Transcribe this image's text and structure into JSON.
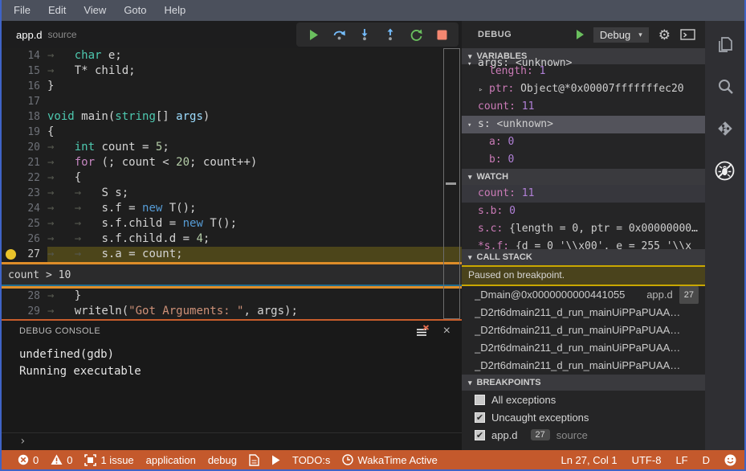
{
  "window": {
    "border_color": "#3f63c6",
    "accent_orange": "#c4592c",
    "accent_yellow": "#e9c32a"
  },
  "menu": {
    "items": [
      "File",
      "Edit",
      "View",
      "Goto",
      "Help"
    ]
  },
  "tab": {
    "file": "app.d",
    "hint": "source"
  },
  "debug_toolbar": {
    "buttons": [
      {
        "icon": "continue-icon"
      },
      {
        "icon": "step-over-icon"
      },
      {
        "icon": "step-into-icon"
      },
      {
        "icon": "step-out-icon"
      },
      {
        "icon": "restart-icon"
      },
      {
        "icon": "stop-icon"
      }
    ]
  },
  "editor": {
    "current_line": 27,
    "breakpoint_line": 27,
    "condition_text": "count > 10",
    "lines": [
      {
        "num": 14,
        "tokens": [
          [
            "ws",
            "→   "
          ],
          [
            "kw",
            "char"
          ],
          [
            "pl",
            " e;"
          ]
        ]
      },
      {
        "num": 15,
        "tokens": [
          [
            "ws",
            "→   "
          ],
          [
            "pl",
            "T* child;"
          ]
        ]
      },
      {
        "num": 16,
        "tokens": [
          [
            "pl",
            "}"
          ]
        ]
      },
      {
        "num": 17,
        "tokens": []
      },
      {
        "num": 18,
        "tokens": [
          [
            "kw",
            "void"
          ],
          [
            "pl",
            " main("
          ],
          [
            "kw",
            "string"
          ],
          [
            "pl",
            "[] "
          ],
          [
            "arg",
            "args"
          ],
          [
            "pl",
            ")"
          ]
        ]
      },
      {
        "num": 19,
        "tokens": [
          [
            "pl",
            "{"
          ]
        ]
      },
      {
        "num": 20,
        "tokens": [
          [
            "ws",
            "→   "
          ],
          [
            "kw",
            "int"
          ],
          [
            "pl",
            " count = "
          ],
          [
            "num",
            "5"
          ],
          [
            "pl",
            ";"
          ]
        ]
      },
      {
        "num": 21,
        "tokens": [
          [
            "ws",
            "→   "
          ],
          [
            "ctrl",
            "for"
          ],
          [
            "pl",
            " (; count < "
          ],
          [
            "num",
            "20"
          ],
          [
            "pl",
            "; count++)"
          ]
        ]
      },
      {
        "num": 22,
        "tokens": [
          [
            "ws",
            "→   "
          ],
          [
            "pl",
            "{"
          ]
        ]
      },
      {
        "num": 23,
        "tokens": [
          [
            "ws",
            "→   "
          ],
          [
            "ws",
            "→   "
          ],
          [
            "pl",
            "S s;"
          ]
        ]
      },
      {
        "num": 24,
        "tokens": [
          [
            "ws",
            "→   "
          ],
          [
            "ws",
            "→   "
          ],
          [
            "pl",
            "s.f = "
          ],
          [
            "new",
            "new"
          ],
          [
            "pl",
            " T();"
          ]
        ]
      },
      {
        "num": 25,
        "tokens": [
          [
            "ws",
            "→   "
          ],
          [
            "ws",
            "→   "
          ],
          [
            "pl",
            "s.f.child = "
          ],
          [
            "new",
            "new"
          ],
          [
            "pl",
            " T();"
          ]
        ]
      },
      {
        "num": 26,
        "tokens": [
          [
            "ws",
            "→   "
          ],
          [
            "ws",
            "→   "
          ],
          [
            "pl",
            "s.f.child.d = "
          ],
          [
            "num",
            "4"
          ],
          [
            "pl",
            ";"
          ]
        ]
      },
      {
        "num": 27,
        "current": true,
        "breakpoint": true,
        "tokens": [
          [
            "ws",
            "→   "
          ],
          [
            "ws",
            "→   "
          ],
          [
            "pl",
            "s.a = count;"
          ]
        ]
      },
      {
        "num": 28,
        "tokens": [
          [
            "ws",
            "→   "
          ],
          [
            "pl",
            "}"
          ]
        ]
      },
      {
        "num": 29,
        "tokens": [
          [
            "ws",
            "→   "
          ],
          [
            "pl",
            "writeln("
          ],
          [
            "str",
            "\"Got Arguments: \""
          ],
          [
            "pl",
            ", args);"
          ]
        ]
      }
    ]
  },
  "debug_console": {
    "title": "DEBUG CONSOLE",
    "lines": [
      "undefined(gdb)",
      "Running executable"
    ],
    "prompt": "›"
  },
  "side_panel": {
    "title": "DEBUG",
    "profile": "Debug",
    "profile_caret": "▾",
    "variables": {
      "title": "VARIABLES",
      "rows": [
        {
          "clip": true,
          "level": 1,
          "twistie": "open",
          "name": "args:",
          "value": "<unknown>",
          "vclass": "txt",
          "plain": true
        },
        {
          "level": 2,
          "name": "length:",
          "value": "1",
          "vclass": "num"
        },
        {
          "level": 2,
          "twistie": "closed",
          "name": "ptr:",
          "value": "Object@*0x00007fffffffec20",
          "vclass": "txt"
        },
        {
          "level": 1,
          "name": "count:",
          "value": "11",
          "vclass": "num"
        },
        {
          "level": 1,
          "twistie": "open",
          "name": "s:",
          "value": "<unknown>",
          "vclass": "txt",
          "plain": true,
          "selected": true
        },
        {
          "level": 2,
          "name": "a:",
          "value": "0",
          "vclass": "num"
        },
        {
          "level": 2,
          "name": "b:",
          "value": "0",
          "vclass": "num"
        }
      ]
    },
    "watch": {
      "title": "WATCH",
      "rows": [
        {
          "name": "count:",
          "value": "11",
          "vclass": "num",
          "hl": true
        },
        {
          "name": "s.b:",
          "value": "0",
          "vclass": "num"
        },
        {
          "name": "s.c:",
          "value": "{length = 0, ptr = 0x00000000…",
          "vclass": "txt"
        },
        {
          "name": "*s.f:",
          "value": "{d = 0 '\\\\x00', e = 255 '\\\\x",
          "vclass": "txt",
          "clip": true
        }
      ]
    },
    "call_stack": {
      "title": "CALL STACK",
      "status": "Paused on breakpoint.",
      "frames": [
        {
          "name": "_Dmain@0x0000000000441055",
          "file": "app.d",
          "line": "27"
        },
        {
          "name": "_D2rt6dmain211_d_run_mainUiPPaPUAA…"
        },
        {
          "name": "_D2rt6dmain211_d_run_mainUiPPaPUAA…"
        },
        {
          "name": "_D2rt6dmain211_d_run_mainUiPPaPUAA…"
        },
        {
          "name": "_D2rt6dmain211_d_run_mainUiPPaPUAA…"
        }
      ]
    },
    "breakpoints": {
      "title": "BREAKPOINTS",
      "rows": [
        {
          "checked": false,
          "label": "All exceptions"
        },
        {
          "checked": true,
          "label": "Uncaught exceptions"
        },
        {
          "checked": true,
          "label": "app.d",
          "badge": "27",
          "hint": "source"
        }
      ]
    }
  },
  "activity_bar": {
    "items": [
      {
        "icon": "files-icon"
      },
      {
        "icon": "search-icon"
      },
      {
        "icon": "source-control-icon"
      },
      {
        "icon": "debug-disabled-icon",
        "active": true
      }
    ]
  },
  "status_bar": {
    "left": [
      {
        "icon": "error-icon",
        "label": "0"
      },
      {
        "icon": "warning-icon",
        "label": "0"
      },
      {
        "icon": "issues-icon",
        "label": "1 issue"
      },
      {
        "label": "application"
      },
      {
        "label": "debug"
      },
      {
        "icon": "file-icon"
      },
      {
        "icon": "play-icon"
      },
      {
        "label": "TODO:s"
      },
      {
        "icon": "clock-icon",
        "label": "WakaTime Active"
      }
    ],
    "right": [
      {
        "label": "Ln 27, Col 1"
      },
      {
        "label": "UTF-8"
      },
      {
        "label": "LF"
      },
      {
        "label": "D"
      },
      {
        "icon": "smiley-icon"
      }
    ]
  }
}
